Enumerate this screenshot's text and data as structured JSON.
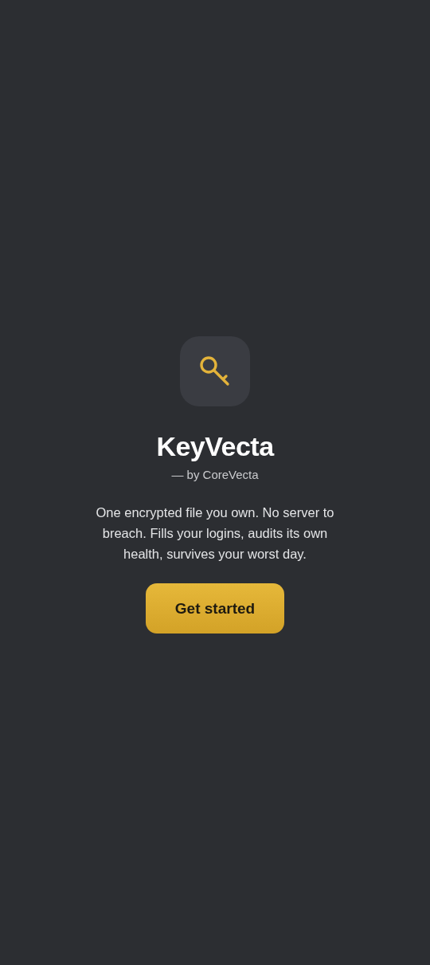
{
  "app": {
    "name": "KeyVecta",
    "byline": "— by CoreVecta"
  },
  "description": "One encrypted file you own. No server to breach. Fills your logins, audits its own health, survives your worst day.",
  "buttons": [
    {
      "label": "Get started",
      "kind": "primary"
    }
  ]
}
